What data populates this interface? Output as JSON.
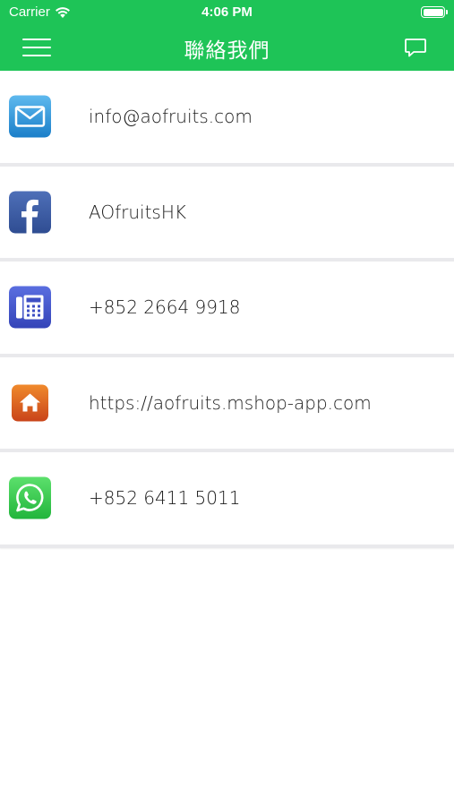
{
  "status_bar": {
    "carrier": "Carrier",
    "time": "4:06 PM"
  },
  "navbar": {
    "title": "聯絡我們"
  },
  "contacts": [
    {
      "type": "email",
      "icon": "mail-icon",
      "label": "info@aofruits.com"
    },
    {
      "type": "facebook",
      "icon": "facebook-icon",
      "label": "AOfruitsHK"
    },
    {
      "type": "phone",
      "icon": "phone-icon",
      "label": "+852 2664 9918"
    },
    {
      "type": "website",
      "icon": "home-icon",
      "label": "https://aofruits.mshop-app.com"
    },
    {
      "type": "whatsapp",
      "icon": "whatsapp-icon",
      "label": "+852 6411 5011"
    }
  ],
  "colors": {
    "brand_green": "#1ec457",
    "divider": "#e9e9ec"
  }
}
